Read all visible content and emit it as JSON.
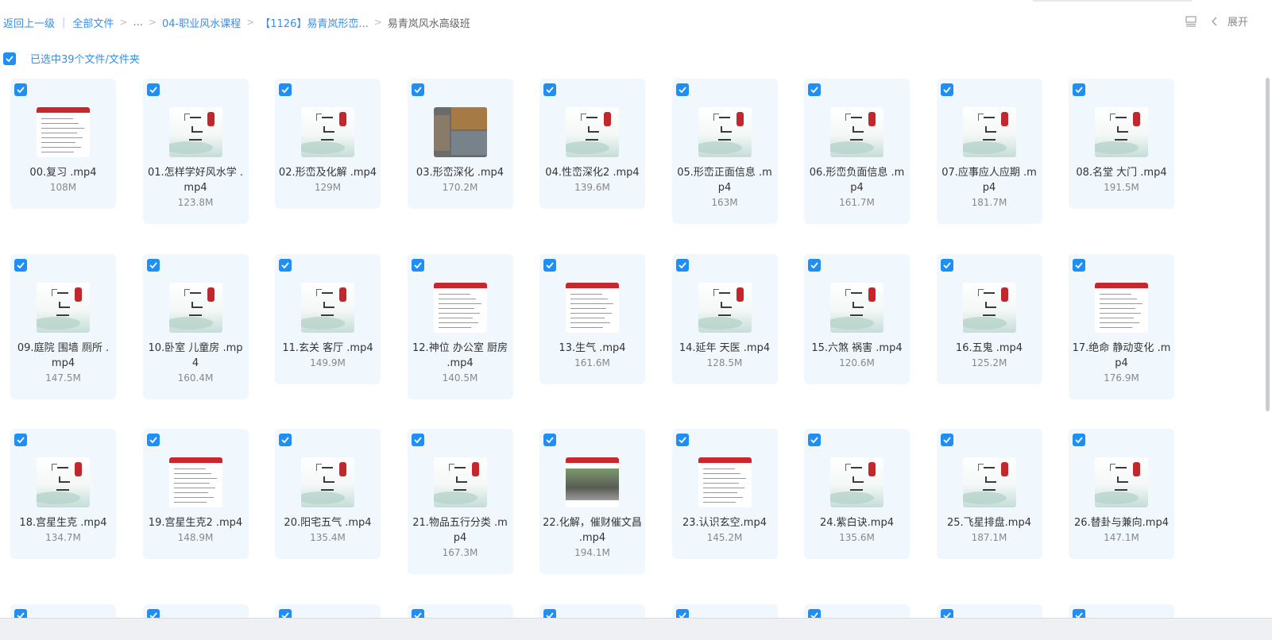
{
  "breadcrumb": {
    "back": "返回上一级",
    "items": [
      "全部文件",
      "...",
      "04-职业风水课程",
      "【1126】易青岚形峦..."
    ],
    "current": "易青岚风水高级班"
  },
  "toolbar": {
    "expand_label": "展开"
  },
  "selection": {
    "text": "已选中39个文件/文件夹",
    "checked": true
  },
  "files": [
    {
      "name": "00.复习 .mp4",
      "size": "108M",
      "thumb": "doc"
    },
    {
      "name": "01.怎样学好风水学 .mp4",
      "size": "123.8M",
      "thumb": "title"
    },
    {
      "name": "02.形峦及化解 .mp4",
      "size": "129M",
      "thumb": "title"
    },
    {
      "name": "03.形峦深化 .mp4",
      "size": "170.2M",
      "thumb": "photo"
    },
    {
      "name": "04.性峦深化2 .mp4",
      "size": "139.6M",
      "thumb": "title"
    },
    {
      "name": "05.形峦正面信息 .mp4",
      "size": "163M",
      "thumb": "title"
    },
    {
      "name": "06.形峦负面信息 .mp4",
      "size": "161.7M",
      "thumb": "title"
    },
    {
      "name": "07.应事应人应期 .mp4",
      "size": "181.7M",
      "thumb": "title"
    },
    {
      "name": "08.名堂 大门 .mp4",
      "size": "191.5M",
      "thumb": "title"
    },
    {
      "name": "09.庭院 围墙 厕所 .mp4",
      "size": "147.5M",
      "thumb": "title"
    },
    {
      "name": "10.卧室 儿童房 .mp4",
      "size": "160.4M",
      "thumb": "title"
    },
    {
      "name": "11.玄关 客厅 .mp4",
      "size": "149.9M",
      "thumb": "title"
    },
    {
      "name": "12.神位 办公室 厨房 .mp4",
      "size": "140.5M",
      "thumb": "doc"
    },
    {
      "name": "13.生气 .mp4",
      "size": "161.6M",
      "thumb": "doc"
    },
    {
      "name": "14.延年 天医 .mp4",
      "size": "128.5M",
      "thumb": "title"
    },
    {
      "name": "15.六煞 祸害 .mp4",
      "size": "120.6M",
      "thumb": "title"
    },
    {
      "name": "16.五鬼 .mp4",
      "size": "125.2M",
      "thumb": "title"
    },
    {
      "name": "17.绝命 静动变化 .mp4",
      "size": "176.9M",
      "thumb": "doc"
    },
    {
      "name": "18.宫星生克 .mp4",
      "size": "134.7M",
      "thumb": "title"
    },
    {
      "name": "19.宫星生克2 .mp4",
      "size": "148.9M",
      "thumb": "doc"
    },
    {
      "name": "20.阳宅五气 .mp4",
      "size": "135.4M",
      "thumb": "title"
    },
    {
      "name": "21.物品五行分类 .mp4",
      "size": "167.3M",
      "thumb": "title"
    },
    {
      "name": "22.化解，催财催文昌 .mp4",
      "size": "194.1M",
      "thumb": "house"
    },
    {
      "name": "23.认识玄空.mp4",
      "size": "145.2M",
      "thumb": "doc"
    },
    {
      "name": "24.紫白诀.mp4",
      "size": "135.6M",
      "thumb": "title"
    },
    {
      "name": "25.飞星排盘.mp4",
      "size": "187.1M",
      "thumb": "title"
    },
    {
      "name": "26.替卦与兼向.mp4",
      "size": "147.1M",
      "thumb": "title"
    },
    {
      "name": "",
      "size": "",
      "thumb": "none"
    },
    {
      "name": "",
      "size": "",
      "thumb": "none"
    },
    {
      "name": "",
      "size": "",
      "thumb": "none"
    },
    {
      "name": "",
      "size": "",
      "thumb": "none"
    },
    {
      "name": "",
      "size": "",
      "thumb": "none"
    },
    {
      "name": "",
      "size": "",
      "thumb": "none"
    },
    {
      "name": "",
      "size": "",
      "thumb": "none"
    },
    {
      "name": "",
      "size": "",
      "thumb": "none"
    },
    {
      "name": "",
      "size": "",
      "thumb": "none"
    }
  ]
}
